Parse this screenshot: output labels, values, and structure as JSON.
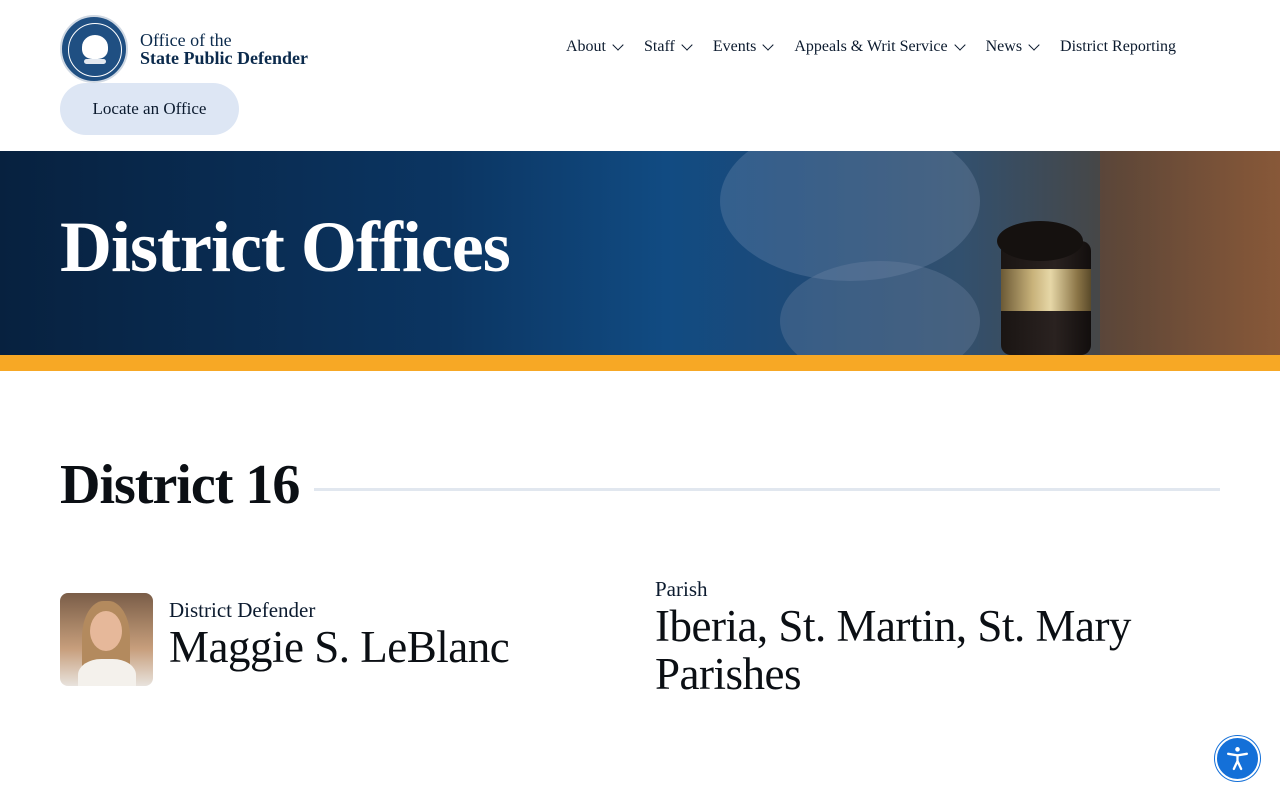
{
  "header": {
    "logo_line1": "Office of the",
    "logo_line2": "State Public Defender",
    "nav": [
      {
        "label": "About",
        "has_dropdown": true
      },
      {
        "label": "Staff",
        "has_dropdown": true
      },
      {
        "label": "Events",
        "has_dropdown": true
      },
      {
        "label": "Appeals & Writ Service",
        "has_dropdown": true
      },
      {
        "label": "News",
        "has_dropdown": true
      },
      {
        "label": "District Reporting",
        "has_dropdown": false
      }
    ],
    "locate_button": "Locate an Office"
  },
  "hero": {
    "title": "District Offices"
  },
  "district": {
    "title": "District 16",
    "defender_label": "District Defender",
    "defender_name": "Maggie S. LeBlanc",
    "parish_label": "Parish",
    "parish_value": "Iberia, St. Martin, St. Mary Parishes"
  },
  "icons": {
    "seal": "state-seal-icon",
    "chevron": "chevron-down-icon",
    "accessibility": "accessibility-icon",
    "gavel": "gavel-image"
  },
  "colors": {
    "accent_bar": "#f7a825",
    "hero_dark": "#07213f",
    "locate_button_bg": "#dde6f4",
    "accessibility_button": "#1470d8"
  }
}
